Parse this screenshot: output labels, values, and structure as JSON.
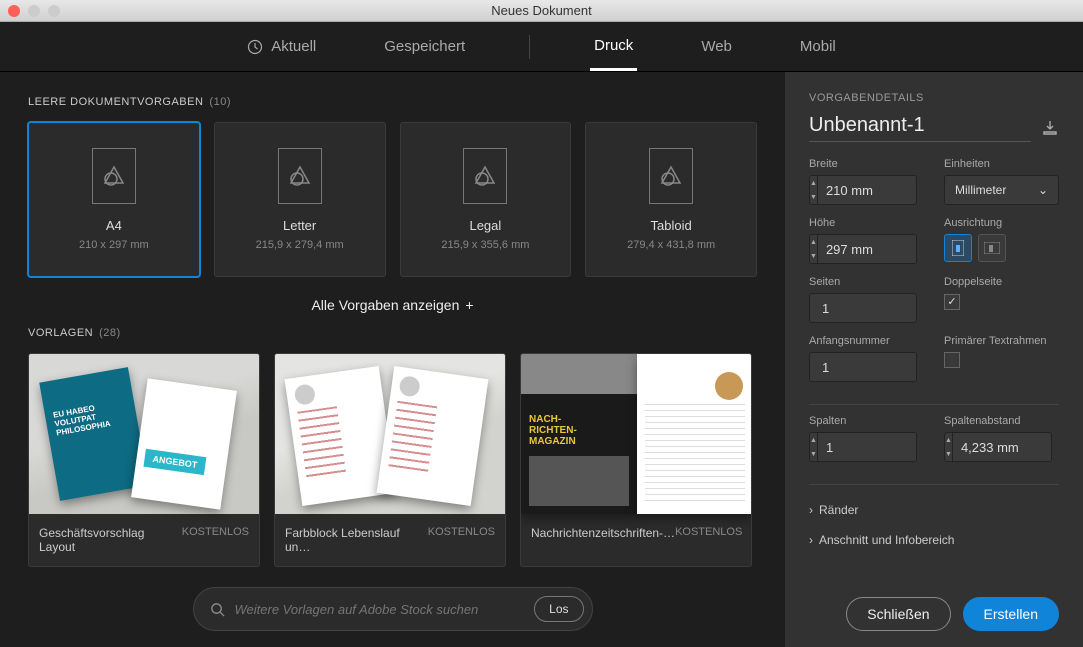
{
  "window": {
    "title": "Neues Dokument"
  },
  "tabs": {
    "recent": "Aktuell",
    "saved": "Gespeichert",
    "print": "Druck",
    "web": "Web",
    "mobile": "Mobil"
  },
  "presets": {
    "heading": "LEERE DOKUMENTVORGABEN",
    "count": "(10)",
    "items": [
      {
        "name": "A4",
        "size": "210 x 297 mm"
      },
      {
        "name": "Letter",
        "size": "215,9 x 279,4 mm"
      },
      {
        "name": "Legal",
        "size": "215,9 x 355,6 mm"
      },
      {
        "name": "Tabloid",
        "size": "279,4 x 431,8 mm"
      }
    ],
    "showall": "Alle Vorgaben anzeigen"
  },
  "templates": {
    "heading": "VORLAGEN",
    "count": "(28)",
    "items": [
      {
        "name": "Geschäftsvorschlag Layout",
        "price": "KOSTENLOS"
      },
      {
        "name": "Farbblock Lebenslauf un…",
        "price": "KOSTENLOS"
      },
      {
        "name": "Nachrichtenzeitschriften-…",
        "price": "KOSTENLOS"
      }
    ]
  },
  "search": {
    "placeholder": "Weitere Vorlagen auf Adobe Stock suchen",
    "go": "Los"
  },
  "details": {
    "heading": "VORGABENDETAILS",
    "docname": "Unbenannt-1",
    "labels": {
      "width": "Breite",
      "units": "Einheiten",
      "height": "Höhe",
      "orientation": "Ausrichtung",
      "pages": "Seiten",
      "facing": "Doppelseite",
      "startnum": "Anfangsnummer",
      "primarytf": "Primärer Textrahmen",
      "columns": "Spalten",
      "gutter": "Spaltenabstand"
    },
    "values": {
      "width": "210 mm",
      "height": "297 mm",
      "units": "Millimeter",
      "pages": "1",
      "startnum": "1",
      "columns": "1",
      "gutter": "4,233 mm",
      "facing": true,
      "primarytf": false
    },
    "accordions": {
      "margins": "Ränder",
      "bleed": "Anschnitt und Infobereich"
    }
  },
  "buttons": {
    "close": "Schließen",
    "create": "Erstellen"
  }
}
